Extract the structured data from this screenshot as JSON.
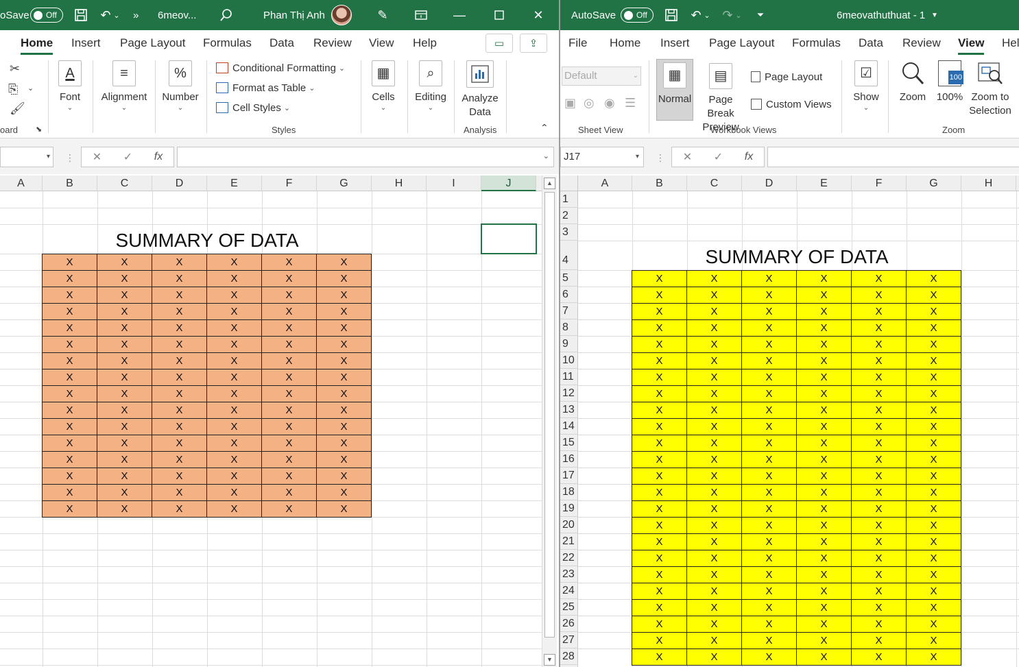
{
  "left": {
    "titlebar": {
      "autosave_label": "oSave",
      "autosave_state": "Off",
      "filename": "6meov...",
      "more": "»",
      "user": "Phan Thị Anh"
    },
    "tabs": [
      "Home",
      "Insert",
      "Page Layout",
      "Formulas",
      "Data",
      "Review",
      "View",
      "Help"
    ],
    "active_tab": "Home",
    "ribbon": {
      "clipboard_label": "oard",
      "font_label": "Font",
      "alignment_label": "Alignment",
      "number_label": "Number",
      "conditional_formatting": "Conditional Formatting",
      "format_as_table": "Format as Table",
      "cell_styles": "Cell Styles",
      "styles_label": "Styles",
      "cells_label": "Cells",
      "editing_label": "Editing",
      "analyze_data_line1": "Analyze",
      "analyze_data_line2": "Data",
      "analysis_label": "Analysis"
    },
    "formula_bar": {
      "name_box": "",
      "formula": ""
    },
    "columns": [
      "A",
      "B",
      "C",
      "D",
      "E",
      "F",
      "G",
      "H",
      "I",
      "J"
    ],
    "selected_column": "J",
    "sheet_title": "SUMMARY OF DATA",
    "table": {
      "rows": 16,
      "cols": 6,
      "cell_value": "X",
      "fill_color": "#f4b183"
    }
  },
  "right": {
    "titlebar": {
      "autosave_label": "AutoSave",
      "autosave_state": "Off",
      "filename": "6meovathuthuat  -  1"
    },
    "tabs": [
      "File",
      "Home",
      "Insert",
      "Page Layout",
      "Formulas",
      "Data",
      "Review",
      "View",
      "Hel"
    ],
    "active_tab": "View",
    "ribbon": {
      "sheet_view_default": "Default",
      "sheet_view_label": "Sheet View",
      "normal": "Normal",
      "page_break_line1": "Page Break",
      "page_break_line2": "Preview",
      "page_layout": "Page Layout",
      "custom_views": "Custom Views",
      "workbook_views_label": "Workbook Views",
      "show": "Show",
      "zoom": "Zoom",
      "zoom_100": "100%",
      "zoom_100_badge": "100",
      "zoom_sel_line1": "Zoom to",
      "zoom_sel_line2": "Selection",
      "zoom_group_label": "Zoom"
    },
    "formula_bar": {
      "name_box": "J17",
      "formula": ""
    },
    "columns": [
      "A",
      "B",
      "C",
      "D",
      "E",
      "F",
      "G",
      "H"
    ],
    "row_numbers": [
      "1",
      "2",
      "3",
      "4",
      "5",
      "6",
      "7",
      "8",
      "9",
      "10",
      "11",
      "12",
      "13",
      "14",
      "15",
      "16",
      "17",
      "18",
      "19",
      "20",
      "21",
      "22",
      "23",
      "24",
      "25",
      "26",
      "27",
      "28"
    ],
    "sheet_title": "SUMMARY OF DATA",
    "table": {
      "rows": 24,
      "cols": 6,
      "cell_value": "X",
      "fill_color": "#ffff00"
    }
  },
  "colors": {
    "excel_green": "#217346",
    "orange_fill": "#f4b183",
    "yellow_fill": "#ffff00"
  }
}
